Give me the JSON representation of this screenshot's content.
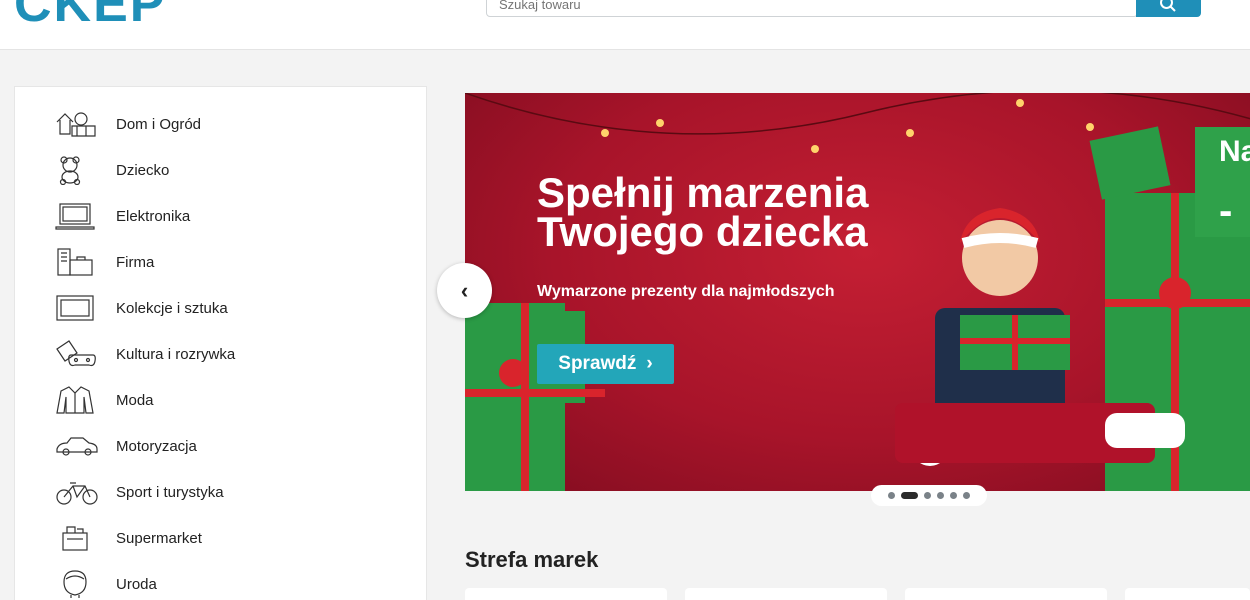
{
  "header": {
    "logo_text": "CKEP",
    "search_placeholder": "Szukaj towaru",
    "brand_color": "#1f8fb8"
  },
  "sidebar": {
    "items": [
      {
        "label": "Dom i Ogród",
        "icon": "house-garden-icon"
      },
      {
        "label": "Dziecko",
        "icon": "teddy-bear-icon"
      },
      {
        "label": "Elektronika",
        "icon": "laptop-icon"
      },
      {
        "label": "Firma",
        "icon": "office-icon"
      },
      {
        "label": "Kolekcje i sztuka",
        "icon": "frame-icon"
      },
      {
        "label": "Kultura i rozrywka",
        "icon": "tickets-gamepad-icon"
      },
      {
        "label": "Moda",
        "icon": "jacket-icon"
      },
      {
        "label": "Motoryzacja",
        "icon": "car-icon"
      },
      {
        "label": "Sport i turystyka",
        "icon": "bicycle-icon"
      },
      {
        "label": "Supermarket",
        "icon": "basket-icon"
      },
      {
        "label": "Uroda",
        "icon": "face-icon"
      }
    ]
  },
  "banner": {
    "title_line1": "Spełnij marzenia",
    "title_line2": "Twojego dziecka",
    "subtitle": "Wymarzone prezenty dla najmłodszych",
    "cta_label": "Sprawdź",
    "badge_text": "Na",
    "badge_sub": "-",
    "background_color": "#b3162c",
    "cta_color": "#23a6b9"
  },
  "carousel": {
    "slides": 6,
    "active_slide": 2
  },
  "brands": {
    "title": "Strefa marek"
  }
}
